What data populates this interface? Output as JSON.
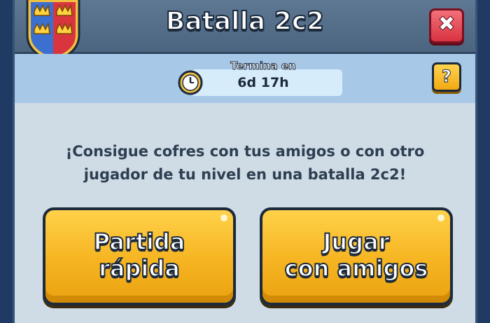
{
  "dialog": {
    "title": "Batalla 2c2",
    "close_icon": "close-icon",
    "help_label": "?",
    "close_label": "✖"
  },
  "timer": {
    "label": "Termina en",
    "value": "6d 17h",
    "icon": "clock-icon"
  },
  "description": {
    "line1": "¡Consigue cofres con tus amigos o con otro",
    "line2": "jugador de tu nivel en una batalla 2c2!"
  },
  "buttons": {
    "quick_match": {
      "line1": "Partida",
      "line2": "rápida"
    },
    "play_with_friends": {
      "line1": "Jugar",
      "line2": "con amigos"
    }
  },
  "colors": {
    "button_gold": "#f6b421",
    "close_red": "#d83340",
    "info_band": "#a8c8e8",
    "panel": "#cfdce6"
  }
}
